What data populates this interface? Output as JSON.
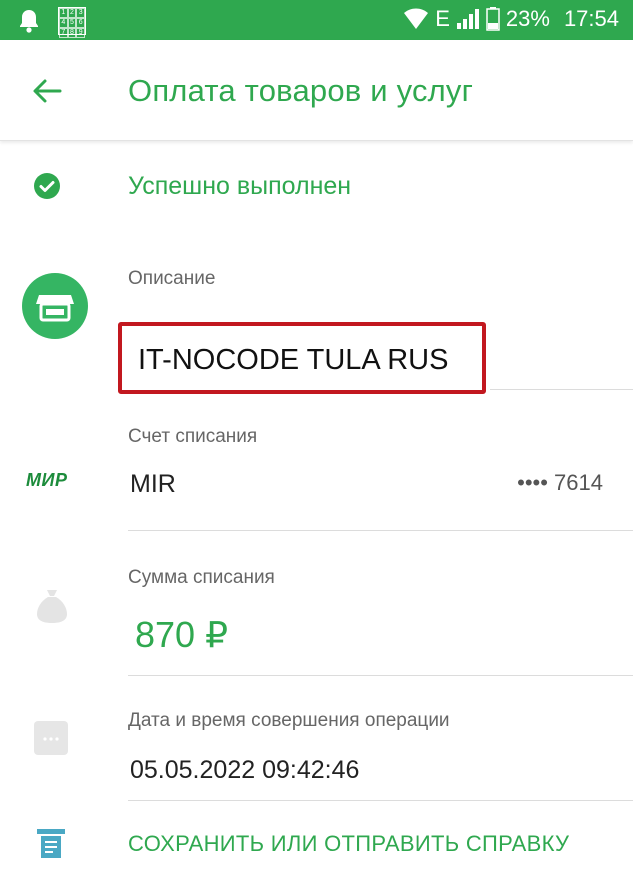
{
  "status_bar": {
    "network": "E",
    "battery": "23%",
    "time": "17:54"
  },
  "header": {
    "title": "Оплата товаров и услуг",
    "back_icon": "arrow-left-icon"
  },
  "operation": {
    "status": "Успешно выполнен",
    "description_label": "Описание",
    "description_value": "IT-NOCODE TULA RUS",
    "account_label": "Счет списания",
    "payment_system": "МИР",
    "account_value": "MIR",
    "card_number": "•••• 7614",
    "amount_label": "Сумма списания",
    "amount_value": "870 ₽",
    "datetime_label": "Дата и время совершения операции",
    "datetime_value": "05.05.2022 09:42:46"
  },
  "actions": {
    "save_label": "СОХРАНИТЬ ИЛИ ОТПРАВИТЬ СПРАВКУ"
  },
  "colors": {
    "accent": "#2fa84f",
    "highlight": "#c2181f"
  }
}
